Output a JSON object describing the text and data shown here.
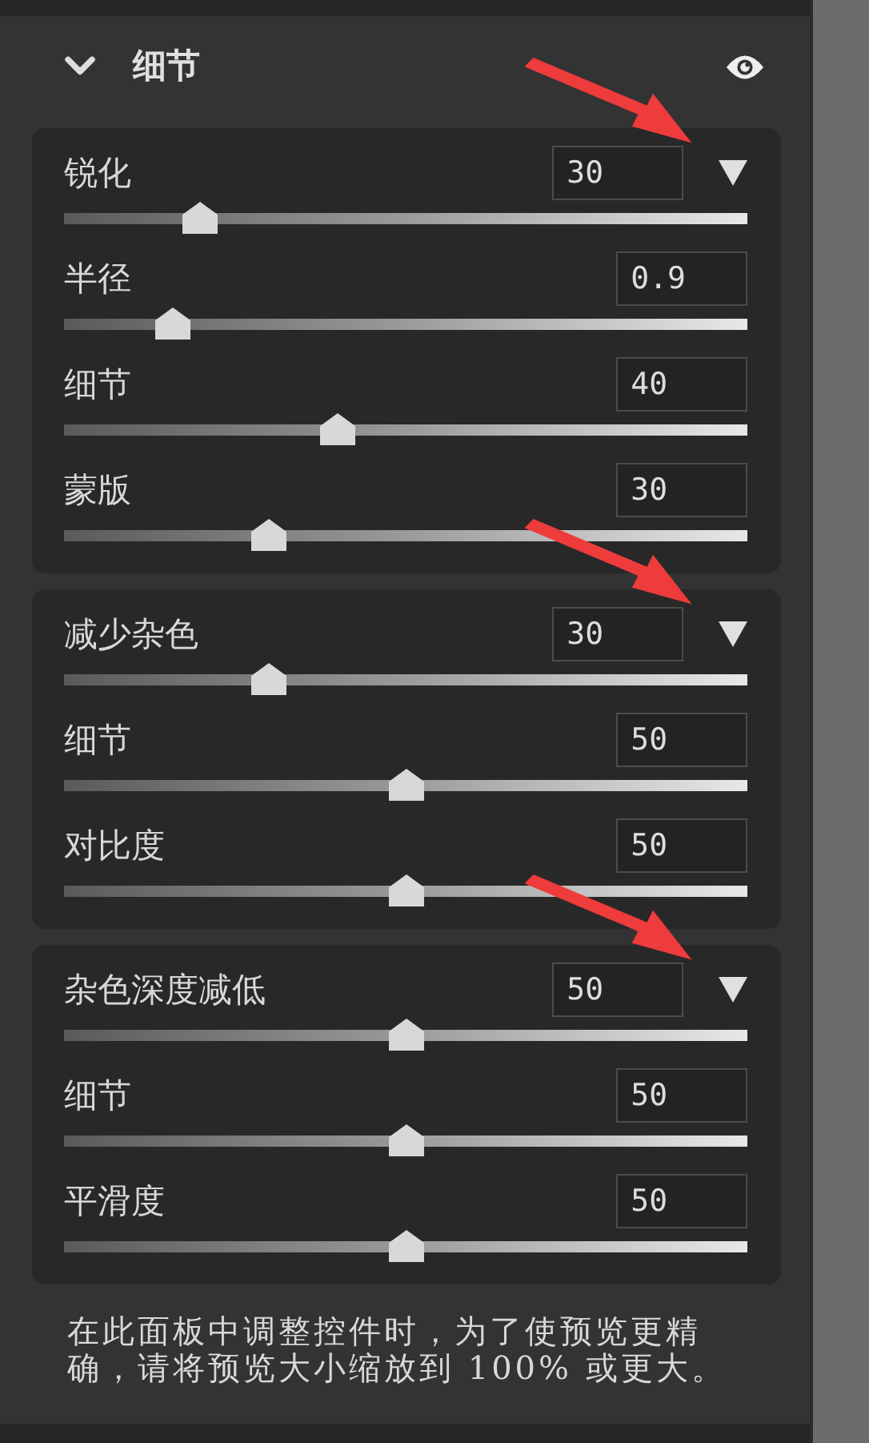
{
  "panel": {
    "title": "细节",
    "expanded": true
  },
  "groups": [
    {
      "annotated": true,
      "controls": [
        {
          "label": "锐化",
          "value": "30",
          "level": 0.2,
          "has_menu": true
        },
        {
          "label": "半径",
          "value": "0.9",
          "level": 0.16,
          "has_menu": false
        },
        {
          "label": "细节",
          "value": "40",
          "level": 0.4,
          "has_menu": false
        },
        {
          "label": "蒙版",
          "value": "30",
          "level": 0.3,
          "has_menu": false
        }
      ]
    },
    {
      "annotated": true,
      "controls": [
        {
          "label": "减少杂色",
          "value": "30",
          "level": 0.3,
          "has_menu": true
        },
        {
          "label": "细节",
          "value": "50",
          "level": 0.5,
          "has_menu": false
        },
        {
          "label": "对比度",
          "value": "50",
          "level": 0.5,
          "has_menu": false
        }
      ]
    },
    {
      "annotated": true,
      "controls": [
        {
          "label": "杂色深度减低",
          "value": "50",
          "level": 0.5,
          "has_menu": true
        },
        {
          "label": "细节",
          "value": "50",
          "level": 0.5,
          "has_menu": false
        },
        {
          "label": "平滑度",
          "value": "50",
          "level": 0.5,
          "has_menu": false
        }
      ]
    }
  ],
  "note": "在此面板中调整控件时，为了使预览更精确，请将预览大小缩放到 100% 或更大。"
}
